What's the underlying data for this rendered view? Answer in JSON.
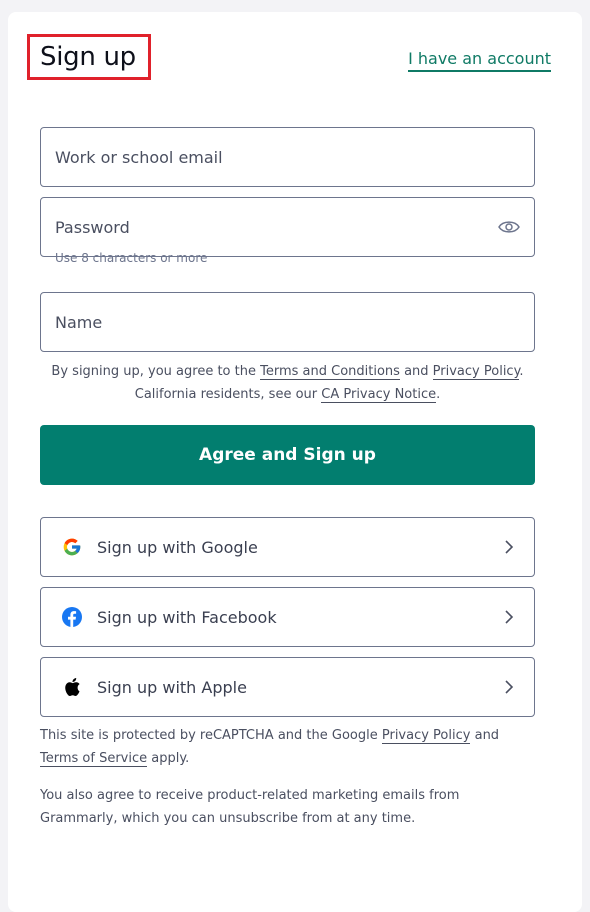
{
  "header": {
    "title": "Sign up",
    "login_link": "I have an account"
  },
  "form": {
    "email_placeholder": "Work or school email",
    "password_placeholder": "Password",
    "password_hint": "Use 8 characters or more",
    "name_placeholder": "Name"
  },
  "terms": {
    "prefix": "By signing up, you agree to the ",
    "terms_link": "Terms and Conditions",
    "and": " and ",
    "privacy_link": "Privacy Policy",
    "period": ".",
    "ca_prefix": "California residents, see our ",
    "ca_link": "CA Privacy Notice",
    "ca_period": "."
  },
  "primary_button": "Agree and Sign up",
  "social": {
    "google": "Sign up with Google",
    "facebook": "Sign up with Facebook",
    "apple": "Sign up with Apple"
  },
  "footer": {
    "recaptcha_prefix": "This site is protected by reCAPTCHA and the Google ",
    "privacy_link": "Privacy Policy",
    "and": " and ",
    "terms_link": "Terms of Service",
    "apply": " apply.",
    "marketing": "You also agree to receive product-related marketing emails from Grammarly, which you can unsubscribe from at any time."
  },
  "colors": {
    "accent": "#027e6f",
    "link": "#0f7a65",
    "highlight_box": "#e0212b",
    "border": "#6d758d"
  },
  "icons": [
    "eye-icon",
    "google-icon",
    "facebook-icon",
    "apple-icon",
    "chevron-right-icon"
  ]
}
